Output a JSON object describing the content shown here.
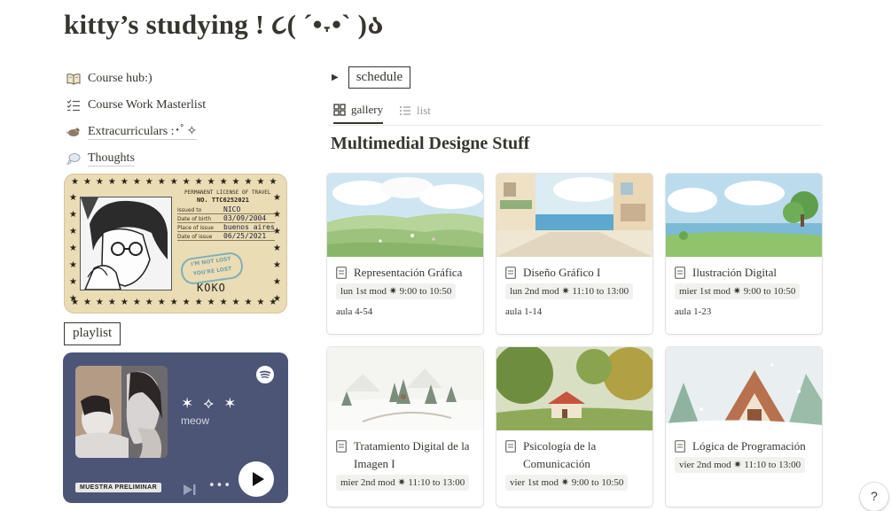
{
  "page": {
    "title": "kitty’s studying ! ૮( ˊ•˕•ˋ )ა"
  },
  "sidebar": {
    "nav": [
      {
        "label": "Course hub:)",
        "icon": "open-book-icon"
      },
      {
        "label": "Course Work Masterlist",
        "icon": "checklist-icon"
      },
      {
        "label": "Extracurriculars :･ﾟ✧",
        "icon": "bird-icon"
      },
      {
        "label": "Thoughts",
        "icon": "thought-bubble-icon"
      }
    ],
    "license": {
      "header": "PERMANENT LICENSE OF TRAVEL",
      "number": "NO. TTC6252021",
      "fields": [
        {
          "label": "Issued to",
          "value": "NICO"
        },
        {
          "label": "Date of birth",
          "value": "03/09/2004"
        },
        {
          "label": "Place of issue",
          "value": "buenos aires"
        },
        {
          "label": "Date of issue",
          "value": "06/25/2021"
        }
      ],
      "stamp": "I'M NOT LOST YOU'RE LOST",
      "signature": "KOKO"
    },
    "playlist_label": "playlist",
    "spotify": {
      "track": "✶ ⟡ ✶",
      "artist": "meow",
      "preview_badge": "MUESTRA PRELIMINAR",
      "more_label": "•••"
    }
  },
  "main": {
    "toggle_label": "schedule",
    "views": [
      {
        "label": "gallery",
        "active": true
      },
      {
        "label": "list",
        "active": false
      }
    ],
    "database_title": "Multimedial Designe Stuff",
    "cards": [
      {
        "title": "Representación Gráfica",
        "schedule": "lun 1st mod ✷ 9:00 to 10:50",
        "aula": "aula 4-54"
      },
      {
        "title": "Diseño Gráfico I",
        "schedule": "lun 2nd mod ✷ 11:10 to 13:00",
        "aula": "aula 1-14"
      },
      {
        "title": "Ilustración Digital",
        "schedule": "mier 1st mod ✷ 9:00 to 10:50",
        "aula": "aula 1-23"
      },
      {
        "title": "Tratamiento Digital de la Imagen I",
        "schedule": "mier 2nd mod ✷ 11:10 to 13:00",
        "aula": ""
      },
      {
        "title": "Psicología de la Comunicación",
        "schedule": "vier 1st mod ✷ 9:00 to 10:50",
        "aula": ""
      },
      {
        "title": "Lógica de Programación",
        "schedule": "vier 2nd mod ✷ 11:10 to 13:00",
        "aula": ""
      }
    ]
  },
  "help_label": "?",
  "colors": {
    "text": "#37352f",
    "muted": "#9b9a97",
    "spotify_bg": "#4c5576",
    "license_bg": "#eadcb4"
  }
}
